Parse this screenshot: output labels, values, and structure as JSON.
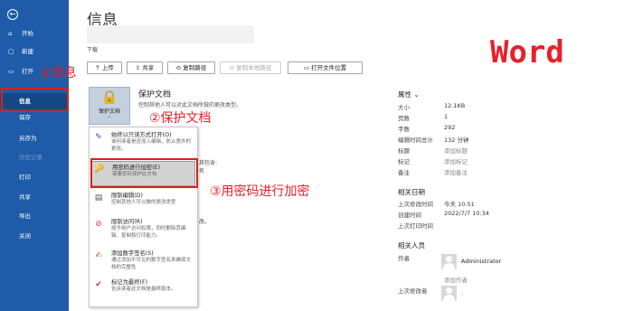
{
  "sidebar": {
    "back_glyph": "←",
    "items": [
      {
        "label": "开始",
        "icon": "home-icon",
        "glyph": "⌂"
      },
      {
        "label": "新建",
        "icon": "new-doc-icon",
        "glyph": "▢"
      },
      {
        "label": "打开",
        "icon": "folder-icon",
        "glyph": "▭"
      },
      {
        "label": "信息",
        "icon": "",
        "glyph": ""
      },
      {
        "label": "保存",
        "icon": "",
        "glyph": ""
      },
      {
        "label": "另存为",
        "icon": "",
        "glyph": ""
      },
      {
        "label": "历史记录",
        "icon": "",
        "glyph": ""
      },
      {
        "label": "打印",
        "icon": "",
        "glyph": ""
      },
      {
        "label": "共享",
        "icon": "",
        "glyph": ""
      },
      {
        "label": "导出",
        "icon": "",
        "glyph": ""
      },
      {
        "label": "关闭",
        "icon": "",
        "glyph": ""
      }
    ]
  },
  "header": {
    "title": "信息",
    "doc_location": "下载"
  },
  "toolbar": {
    "upload": "↑ 上传",
    "share": "共享",
    "copy_path": "复制路径",
    "copy_local_path": "复制本地路径",
    "open_location": "打开文件位置"
  },
  "protect": {
    "tile_label": "保护文档",
    "chevron": "⌄",
    "title": "保护文档",
    "description": "控制其他人可以对此文档所做的更改类型。"
  },
  "background_snippets": {
    "s1": "其包含:",
    "s2": "名",
    "s3": "改。"
  },
  "menu": [
    {
      "title": "始终以只读方式打开(O)",
      "desc": "询问读者是否加入编辑，防止意外的更改。",
      "icon": "pencil-icon",
      "glyph": "✎",
      "color": "#2b579a"
    },
    {
      "title": "用密码进行加密(E)",
      "desc": "需要密码保护此文档",
      "icon": "key-lock-icon",
      "glyph": "🔑",
      "color": "#c08a00"
    },
    {
      "title": "限制编辑(D)",
      "desc": "控制其他人可以做的更改类型",
      "icon": "restrict-doc-icon",
      "glyph": "▤",
      "color": "#555555"
    },
    {
      "title": "限制访问(R)",
      "desc": "授予用户访问权限，同时删除其编辑、复制和打印能力。",
      "icon": "restrict-access-icon",
      "glyph": "⊘",
      "color": "#c0392b"
    },
    {
      "title": "添加数字签名(S)",
      "desc": "通过添加不可见的数字签名来确保文档的完整性",
      "icon": "signature-icon",
      "glyph": "✍",
      "color": "#b5651d"
    },
    {
      "title": "标记为最终(F)",
      "desc": "告诉读者此文档是最终版本。",
      "icon": "final-mark-icon",
      "glyph": "✔",
      "color": "#c0392b"
    }
  ],
  "annotations": {
    "a1": "①信息",
    "a2": "②保护文档",
    "a3": "③用密码进行加密",
    "word": "Word"
  },
  "properties": {
    "title": "属性",
    "title_chevron": "⌄",
    "rows": [
      {
        "key": "大小",
        "value": "12.1KB"
      },
      {
        "key": "页数",
        "value": "1"
      },
      {
        "key": "字数",
        "value": "292"
      },
      {
        "key": "编辑时间总计",
        "value": "132 分钟"
      },
      {
        "key": "标题",
        "value": "添加标题"
      },
      {
        "key": "标记",
        "value": "添加标记"
      },
      {
        "key": "备注",
        "value": "添加备注"
      }
    ],
    "dates_title": "相关日期",
    "dates": [
      {
        "key": "上次修改时间",
        "value": "今天 10:51"
      },
      {
        "key": "创建时间",
        "value": "2022/7/7 10:34"
      },
      {
        "key": "上次打印时间",
        "value": ""
      }
    ],
    "people_title": "相关人员",
    "author_key": "作者",
    "author_name": "Administrator",
    "add_author": "添加作者",
    "last_modified_key": "上次修改者",
    "last_modified_name": "."
  },
  "colors": {
    "sidebar": "#1e5ba8",
    "sidebar_selected": "#154884",
    "annotation_red": "#e8202a"
  }
}
